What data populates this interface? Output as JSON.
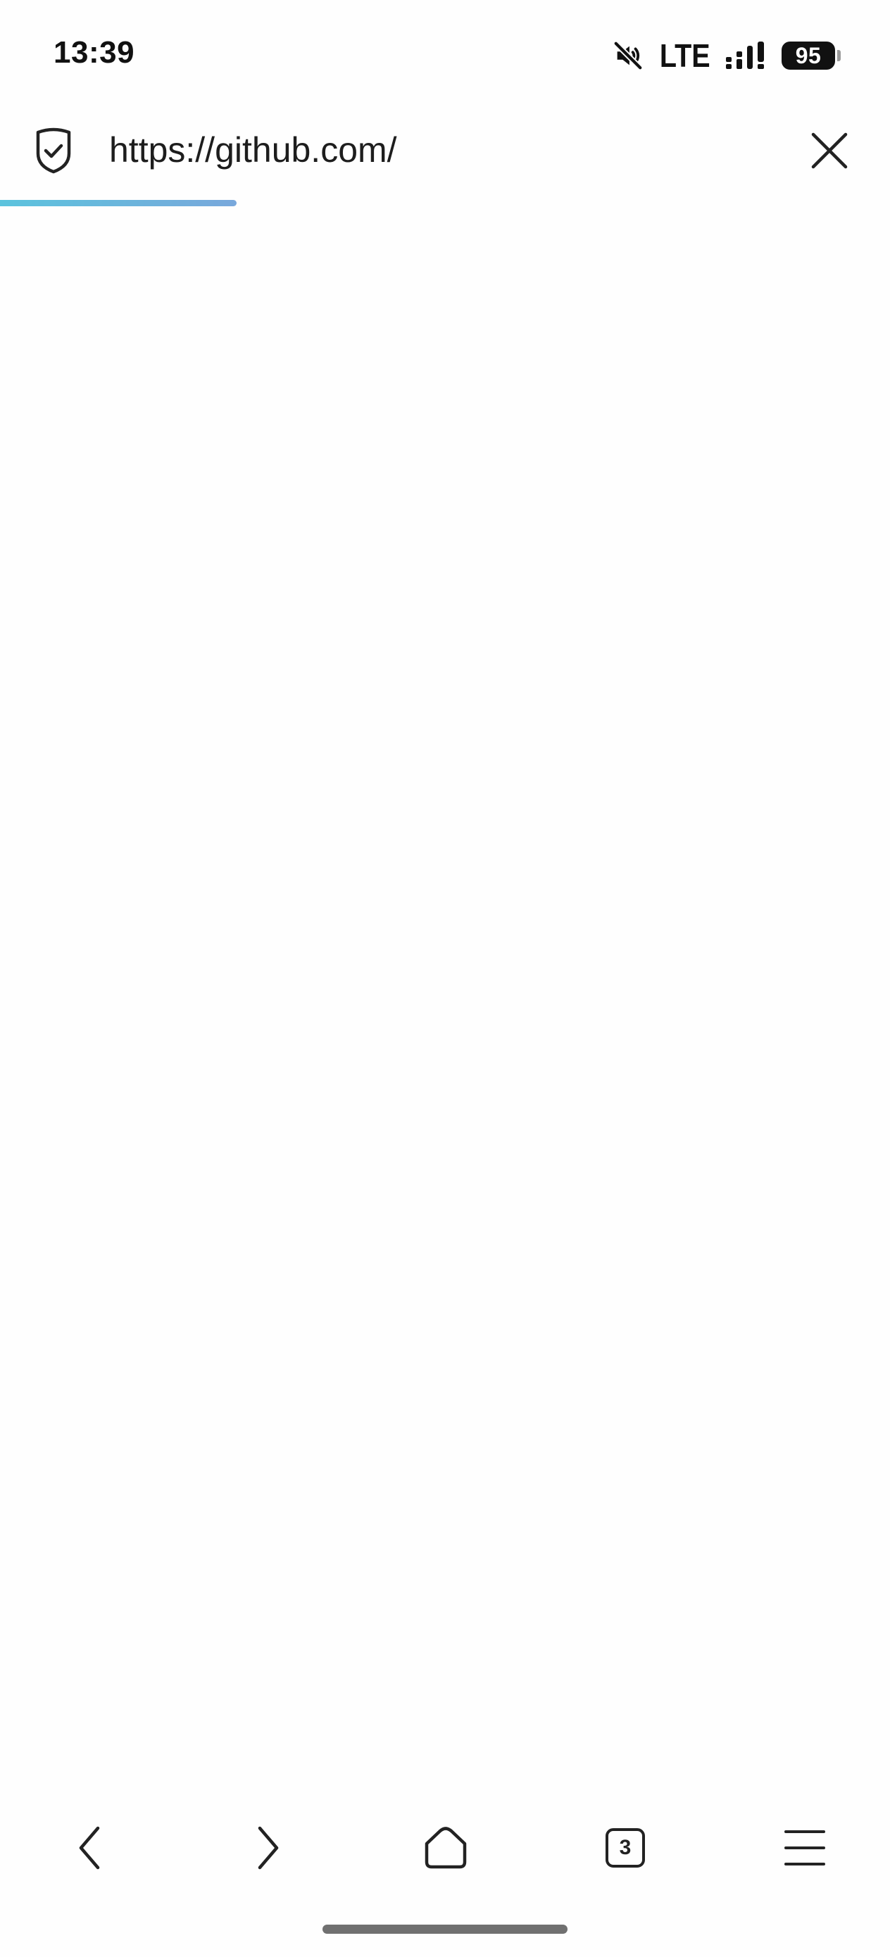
{
  "status_bar": {
    "time": "13:39",
    "network": "LTE",
    "battery_level": "95",
    "sound": "muted",
    "signal_bars_filled": 3,
    "signal_bars_total": 4
  },
  "address_bar": {
    "url": "https://github.com/",
    "security_icon": "shield-check-icon",
    "close_icon": "close-icon",
    "load_progress_percent": 26.6,
    "progress_colors": [
      "#5bc3dd",
      "#79a8dc"
    ]
  },
  "toolbar": {
    "back_icon": "chevron-left-icon",
    "forward_icon": "chevron-right-icon",
    "home_icon": "home-icon",
    "tab_count": "3",
    "menu_icon": "hamburger-menu-icon"
  }
}
